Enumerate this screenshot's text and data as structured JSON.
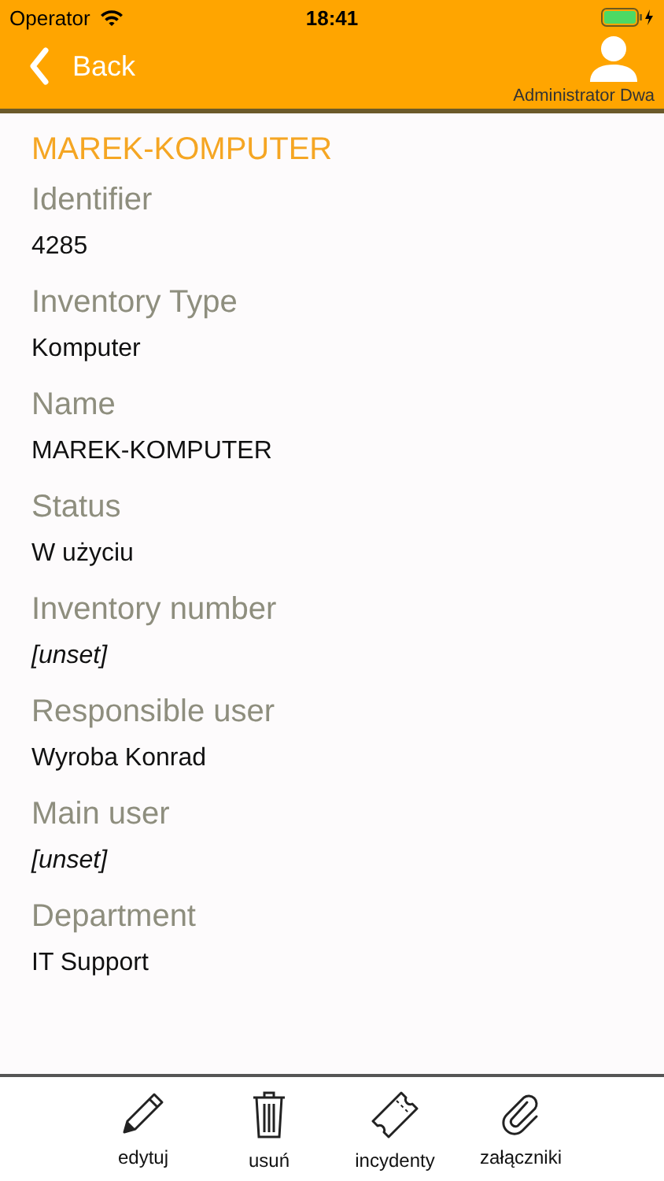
{
  "status_bar": {
    "carrier": "Operator",
    "time": "18:41"
  },
  "nav": {
    "back": "Back",
    "user": "Administrator Dwa"
  },
  "title": "MAREK-KOMPUTER",
  "fields": [
    {
      "label": "Identifier",
      "value": "4285",
      "unset": false
    },
    {
      "label": "Inventory Type",
      "value": "Komputer",
      "unset": false
    },
    {
      "label": "Name",
      "value": "MAREK-KOMPUTER",
      "unset": false
    },
    {
      "label": "Status",
      "value": "W użyciu",
      "unset": false
    },
    {
      "label": "Inventory number",
      "value": "[unset]",
      "unset": true
    },
    {
      "label": "Responsible user",
      "value": "Wyroba Konrad",
      "unset": false
    },
    {
      "label": "Main user",
      "value": "[unset]",
      "unset": true
    },
    {
      "label": "Department",
      "value": "IT Support",
      "unset": false
    }
  ],
  "toolbar": [
    {
      "kind": "edit",
      "label": "edytuj"
    },
    {
      "kind": "delete",
      "label": "usuń"
    },
    {
      "kind": "ticket",
      "label": "incydenty"
    },
    {
      "kind": "attach",
      "label": "załączniki"
    }
  ]
}
